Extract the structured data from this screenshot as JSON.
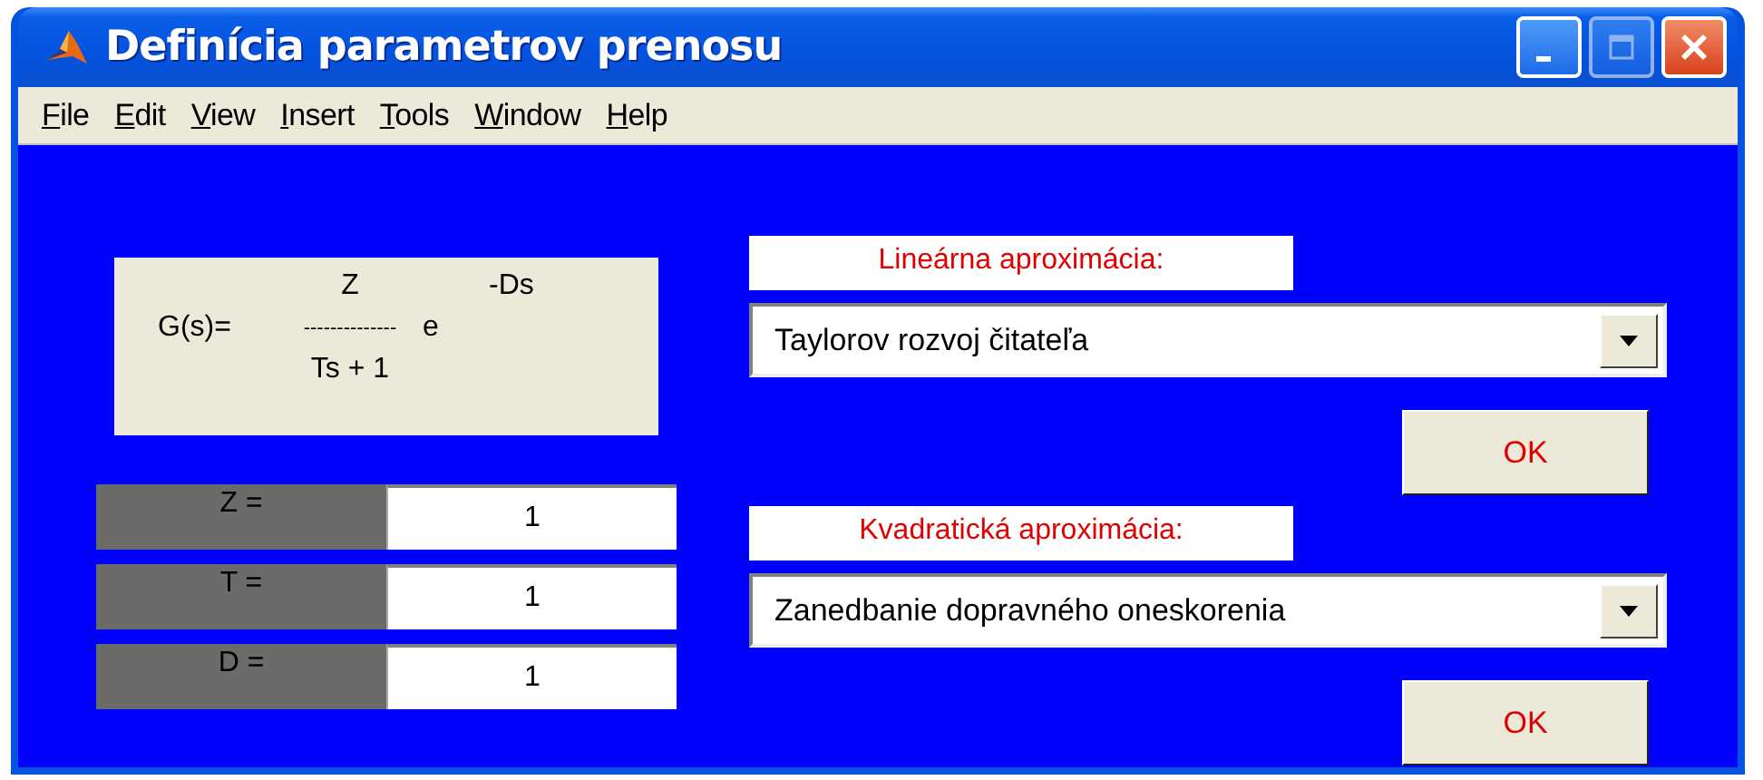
{
  "window": {
    "title": "Definícia parametrov prenosu",
    "title_buttons": [
      {
        "kind": "minimize",
        "disabled": false
      },
      {
        "kind": "maximize",
        "disabled": true
      },
      {
        "kind": "close",
        "disabled": false
      }
    ]
  },
  "menu": [
    "File",
    "Edit",
    "View",
    "Insert",
    "Tools",
    "Window",
    "Help"
  ],
  "formula": {
    "lhs": "G(s)=",
    "numerator": "Z",
    "fraction_bar": "--------------",
    "denominator": "Ts + 1",
    "base": "e",
    "exponent": "-Ds"
  },
  "parameters": [
    {
      "label": "Z =",
      "value": "1"
    },
    {
      "label": "T =",
      "value": "1"
    },
    {
      "label": "D =",
      "value": "1"
    }
  ],
  "approximations": [
    {
      "heading": "Lineárna aproximácia:",
      "selection": "Taylorov rozvoj čitateľa",
      "button": "OK"
    },
    {
      "heading": "Kvadratická aproximácia:",
      "selection": "Zanedbanie dopravného oneskorenia",
      "button": "OK"
    }
  ]
}
